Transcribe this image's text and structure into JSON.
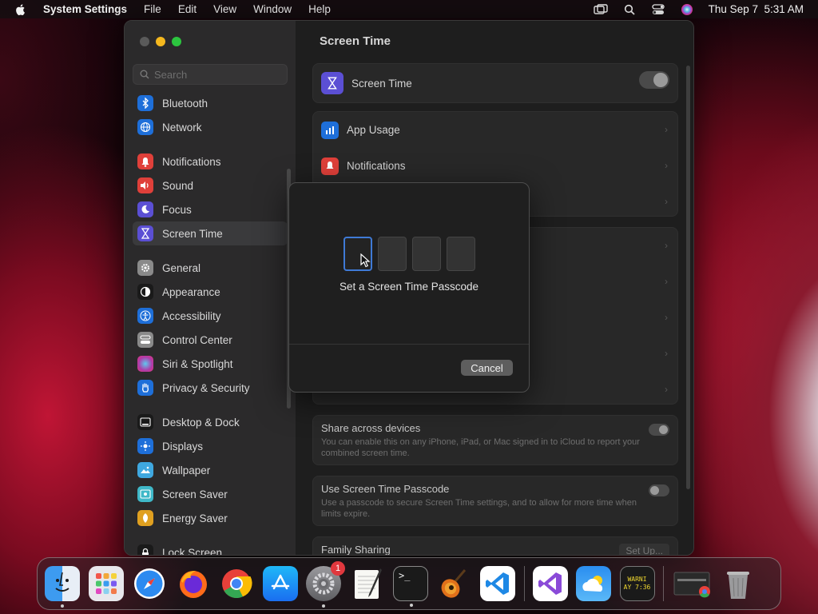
{
  "menubar": {
    "app_name": "System Settings",
    "items": [
      "File",
      "Edit",
      "View",
      "Window",
      "Help"
    ],
    "clock": "Thu Sep 7  5:31 AM"
  },
  "sidebar": {
    "search_placeholder": "Search",
    "items": [
      {
        "label": "Bluetooth",
        "icon": "bluetooth-icon",
        "color": "#1e6fd9"
      },
      {
        "label": "Network",
        "icon": "globe-icon",
        "color": "#1e6fd9"
      },
      {
        "label": "Notifications",
        "icon": "bell-icon",
        "color": "#e0403a"
      },
      {
        "label": "Sound",
        "icon": "speaker-icon",
        "color": "#e0403a"
      },
      {
        "label": "Focus",
        "icon": "moon-icon",
        "color": "#5b4fd4"
      },
      {
        "label": "Screen Time",
        "icon": "hourglass-icon",
        "color": "#5b4fd4"
      },
      {
        "label": "General",
        "icon": "gear-icon",
        "color": "#8a8a8a"
      },
      {
        "label": "Appearance",
        "icon": "appearance-icon",
        "color": "#1a1a1a"
      },
      {
        "label": "Accessibility",
        "icon": "accessibility-icon",
        "color": "#1e6fd9"
      },
      {
        "label": "Control Center",
        "icon": "control-center-icon",
        "color": "#8a8a8a"
      },
      {
        "label": "Siri & Spotlight",
        "icon": "siri-icon",
        "color": "#b03aa8"
      },
      {
        "label": "Privacy & Security",
        "icon": "hand-icon",
        "color": "#1e6fd9"
      },
      {
        "label": "Desktop & Dock",
        "icon": "desktop-icon",
        "color": "#1a1a1a"
      },
      {
        "label": "Displays",
        "icon": "sun-icon",
        "color": "#1e6fd9"
      },
      {
        "label": "Wallpaper",
        "icon": "wallpaper-icon",
        "color": "#3fa8e0"
      },
      {
        "label": "Screen Saver",
        "icon": "screensaver-icon",
        "color": "#3fb8c8"
      },
      {
        "label": "Energy Saver",
        "icon": "battery-icon",
        "color": "#e0a020"
      },
      {
        "label": "Lock Screen",
        "icon": "lock-icon",
        "color": "#1a1a1a"
      }
    ],
    "selected": "Screen Time"
  },
  "content": {
    "title": "Screen Time",
    "main_toggle_label": "Screen Time",
    "rows": [
      {
        "label": "App Usage",
        "icon": "chart-icon",
        "color": "#1e6fd9"
      },
      {
        "label": "Notifications",
        "icon": "bell-icon",
        "color": "#e0403a"
      }
    ],
    "share": {
      "title": "Share across devices",
      "desc": "You can enable this on any iPhone, iPad, or Mac signed in to iCloud to report your combined screen time."
    },
    "passcode": {
      "title": "Use Screen Time Passcode",
      "desc": "Use a passcode to secure Screen Time settings, and to allow for more time when limits expire."
    },
    "family": {
      "title": "Family Sharing",
      "button": "Set Up..."
    }
  },
  "modal": {
    "label": "Set a Screen Time Passcode",
    "cancel": "Cancel"
  },
  "dock": {
    "apps": [
      {
        "name": "Finder",
        "running": true
      },
      {
        "name": "Launchpad",
        "running": false
      },
      {
        "name": "Safari",
        "running": false
      },
      {
        "name": "Firefox",
        "running": false
      },
      {
        "name": "Chrome",
        "running": false
      },
      {
        "name": "App Store",
        "running": false
      },
      {
        "name": "System Settings",
        "running": true,
        "badge": "1"
      },
      {
        "name": "TextEdit",
        "running": false
      },
      {
        "name": "Terminal",
        "running": true
      },
      {
        "name": "GarageBand",
        "running": false
      },
      {
        "name": "VS Code",
        "running": false
      },
      {
        "name": "Visual Studio",
        "running": false
      },
      {
        "name": "Weather",
        "running": false
      },
      {
        "name": "Console",
        "running": false
      }
    ],
    "console_text_1": "WARNI",
    "console_text_2": "AY 7:36"
  }
}
